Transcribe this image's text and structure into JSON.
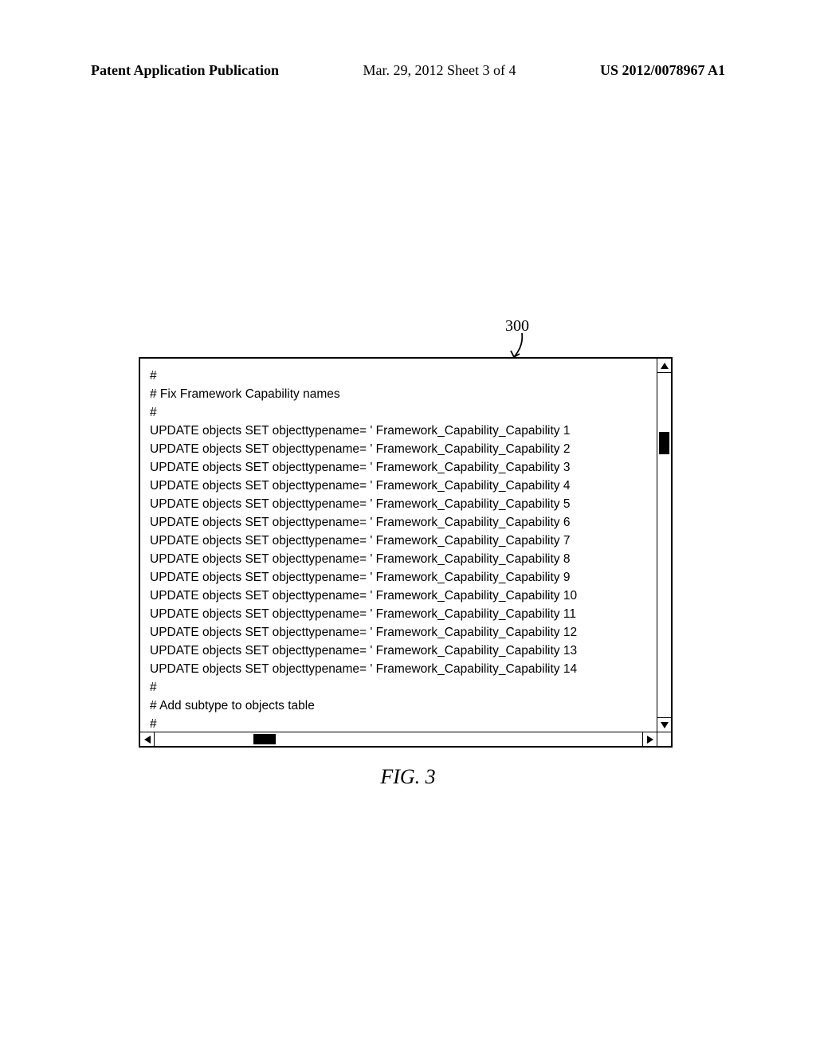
{
  "header": {
    "left": "Patent Application Publication",
    "center": "Mar. 29, 2012  Sheet 3 of 4",
    "right": "US 2012/0078967 A1"
  },
  "reference_numeral": "300",
  "code_lines": [
    "#",
    "# Fix Framework Capability names",
    "#",
    "UPDATE objects SET objecttypename= ' Framework_Capability_Capability 1",
    "UPDATE objects SET objecttypename= ' Framework_Capability_Capability 2",
    "UPDATE objects SET objecttypename= ' Framework_Capability_Capability 3",
    "UPDATE objects SET objecttypename= ' Framework_Capability_Capability 4",
    "UPDATE objects SET objecttypename= ' Framework_Capability_Capability 5",
    "UPDATE objects SET objecttypename= ' Framework_Capability_Capability 6",
    "UPDATE objects SET objecttypename= ' Framework_Capability_Capability 7",
    "UPDATE objects SET objecttypename= ' Framework_Capability_Capability 8",
    "UPDATE objects SET objecttypename= ' Framework_Capability_Capability 9",
    "UPDATE objects SET objecttypename= ' Framework_Capability_Capability 10",
    "UPDATE objects SET objecttypename= ' Framework_Capability_Capability 11",
    "UPDATE objects SET objecttypename= ' Framework_Capability_Capability 12",
    "UPDATE objects SET objecttypename= ' Framework_Capability_Capability 13",
    "UPDATE objects SET objecttypename= ' Framework_Capability_Capability 14",
    "#",
    "# Add subtype to objects table",
    "#"
  ],
  "caption": "FIG. 3"
}
